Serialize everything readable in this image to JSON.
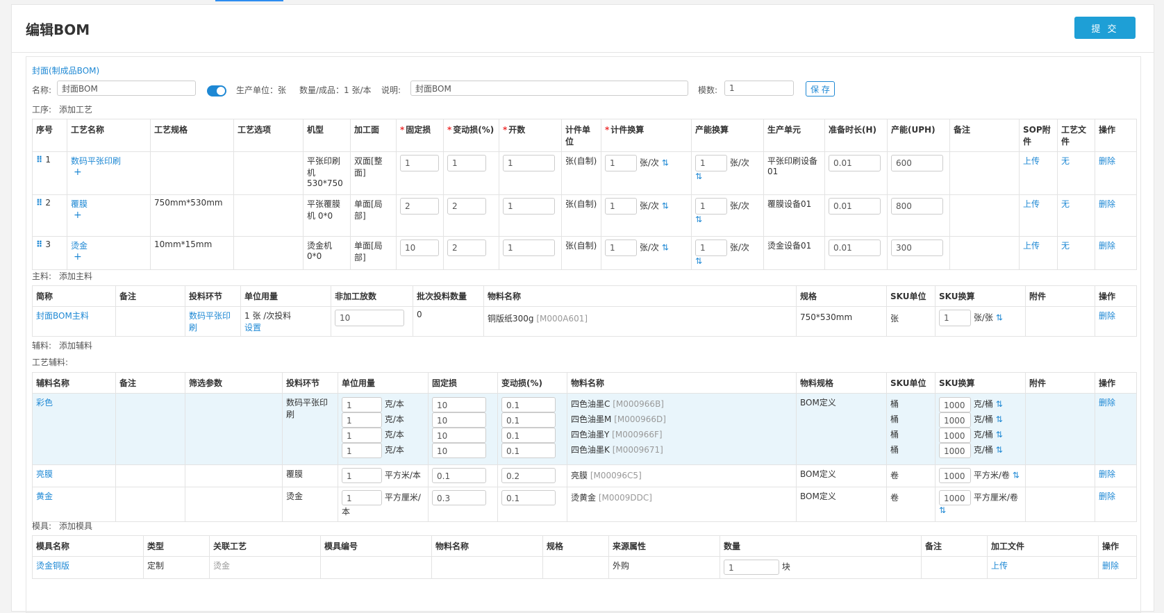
{
  "page_title": "编辑BOM",
  "submit_label": "提 交",
  "bom": {
    "section_title": "封面(制成品BOM)",
    "name_label": "名称:",
    "name_value": "封面BOM",
    "unit_text": "生产单位：张",
    "qty_text": "数量/成品：1 张/本",
    "desc_label": "说明:",
    "desc_value": "封面BOM",
    "mold_label": "模数:",
    "mold_value": "1",
    "save_label": "保 存"
  },
  "process": {
    "label": "工序:",
    "add_label": "添加工艺",
    "headers": [
      "序号",
      "工艺名称",
      "工艺规格",
      "工艺选项",
      "机型",
      "加工面",
      "固定损",
      "变动损(%)",
      "开数",
      "计件单位",
      "计件换算",
      "产能换算",
      "生产单元",
      "准备时长(H)",
      "产能(UPH)",
      "备注",
      "SOP附件",
      "工艺文件",
      "操作"
    ],
    "rows": [
      {
        "no": "1",
        "name": "数码平张印刷",
        "spec": "",
        "option": "",
        "machine": "平张印刷机 530*750",
        "face": "双面[整面]",
        "fixed": "1",
        "var": "1",
        "open": "1",
        "unit": "张(自制)",
        "piece": "1",
        "piece_unit": "张/次",
        "cap": "1",
        "cap_unit": "张/次",
        "cell": "平张印刷设备01",
        "prep": "0.01",
        "uph": "600",
        "note": "",
        "sop": "上传",
        "file": "无",
        "op": "删除"
      },
      {
        "no": "2",
        "name": "覆膜",
        "spec": "750mm*530mm",
        "option": "",
        "machine": "平张覆膜机 0*0",
        "face": "单面[局部]",
        "fixed": "2",
        "var": "2",
        "open": "1",
        "unit": "张(自制)",
        "piece": "1",
        "piece_unit": "张/次",
        "cap": "1",
        "cap_unit": "张/次",
        "cell": "覆膜设备01",
        "prep": "0.01",
        "uph": "800",
        "note": "",
        "sop": "上传",
        "file": "无",
        "op": "删除"
      },
      {
        "no": "3",
        "name": "烫金",
        "spec": "10mm*15mm",
        "option": "",
        "machine": "烫金机 0*0",
        "face": "单面[局部]",
        "fixed": "10",
        "var": "2",
        "open": "1",
        "unit": "张(自制)",
        "piece": "1",
        "piece_unit": "张/次",
        "cap": "1",
        "cap_unit": "张/次",
        "cell": "烫金设备01",
        "prep": "0.01",
        "uph": "300",
        "note": "",
        "sop": "上传",
        "file": "无",
        "op": "删除"
      }
    ]
  },
  "main_material": {
    "label": "主料:",
    "add_label": "添加主料",
    "headers": [
      "简称",
      "备注",
      "投料环节",
      "单位用量",
      "非加工放数",
      "批次投料数量",
      "物料名称",
      "规格",
      "SKU单位",
      "SKU换算",
      "附件",
      "操作"
    ],
    "row": {
      "short": "封面BOM主料",
      "note": "",
      "step": "数码平张印刷",
      "usage": "1 张 /次投料",
      "usage_link": "设置",
      "extra": "10",
      "batch": "0",
      "mat": "铜版纸300g",
      "code": "[M000A601]",
      "spec": "750*530mm",
      "sku": "张",
      "conv": "1",
      "conv_unit": "张/张",
      "attach": "",
      "op": "删除"
    }
  },
  "aux": {
    "label": "辅料:",
    "add_label": "添加辅料",
    "sub_label": "工艺辅料:",
    "headers": [
      "辅料名称",
      "备注",
      "筛选参数",
      "投料环节",
      "单位用量",
      "固定损",
      "变动损(%)",
      "物料名称",
      "物料规格",
      "SKU单位",
      "SKU换算",
      "附件",
      "操作"
    ],
    "rows": [
      {
        "name": "彩色",
        "step": "数码平张印刷",
        "spec": "BOM定义",
        "op": "删除",
        "lines": [
          {
            "usage": "1",
            "uu": "克/本",
            "fixed": "10",
            "var": "0.1",
            "mat": "四色油墨C",
            "code": "[M000966B]",
            "sku": "桶",
            "conv": "1000",
            "cu": "克/桶"
          },
          {
            "usage": "1",
            "uu": "克/本",
            "fixed": "10",
            "var": "0.1",
            "mat": "四色油墨M",
            "code": "[M000966D]",
            "sku": "桶",
            "conv": "1000",
            "cu": "克/桶"
          },
          {
            "usage": "1",
            "uu": "克/本",
            "fixed": "10",
            "var": "0.1",
            "mat": "四色油墨Y",
            "code": "[M000966F]",
            "sku": "桶",
            "conv": "1000",
            "cu": "克/桶"
          },
          {
            "usage": "1",
            "uu": "克/本",
            "fixed": "10",
            "var": "0.1",
            "mat": "四色油墨K",
            "code": "[M0009671]",
            "sku": "桶",
            "conv": "1000",
            "cu": "克/桶"
          }
        ]
      },
      {
        "name": "亮膜",
        "step": "覆膜",
        "spec": "BOM定义",
        "op": "删除",
        "lines": [
          {
            "usage": "1",
            "uu": "平方米/本",
            "fixed": "0.1",
            "var": "0.2",
            "mat": "亮膜",
            "code": "[M00096C5]",
            "sku": "卷",
            "conv": "1000",
            "cu": "平方米/卷"
          }
        ]
      },
      {
        "name": "黄金",
        "step": "烫金",
        "spec": "BOM定义",
        "op": "删除",
        "lines": [
          {
            "usage": "1",
            "uu": "平方厘米/本",
            "fixed": "0.3",
            "var": "0.1",
            "mat": "烫黄金",
            "code": "[M0009DDC]",
            "sku": "卷",
            "conv": "1000",
            "cu": "平方厘米/卷"
          }
        ]
      }
    ]
  },
  "mold": {
    "label": "模具:",
    "add_label": "添加模具",
    "headers": [
      "模具名称",
      "类型",
      "关联工艺",
      "模具编号",
      "物料名称",
      "规格",
      "来源属性",
      "数量",
      "备注",
      "加工文件",
      "操作"
    ],
    "row": {
      "name": "烫金铜版",
      "type": "定制",
      "proc": "烫金",
      "source": "外购",
      "qty": "1",
      "qty_unit": "块",
      "file": "上传",
      "op": "删除"
    }
  },
  "icons": {
    "switch": "swap-vert-icon",
    "drag": "drag-handle-icon",
    "plus": "plus-icon"
  }
}
